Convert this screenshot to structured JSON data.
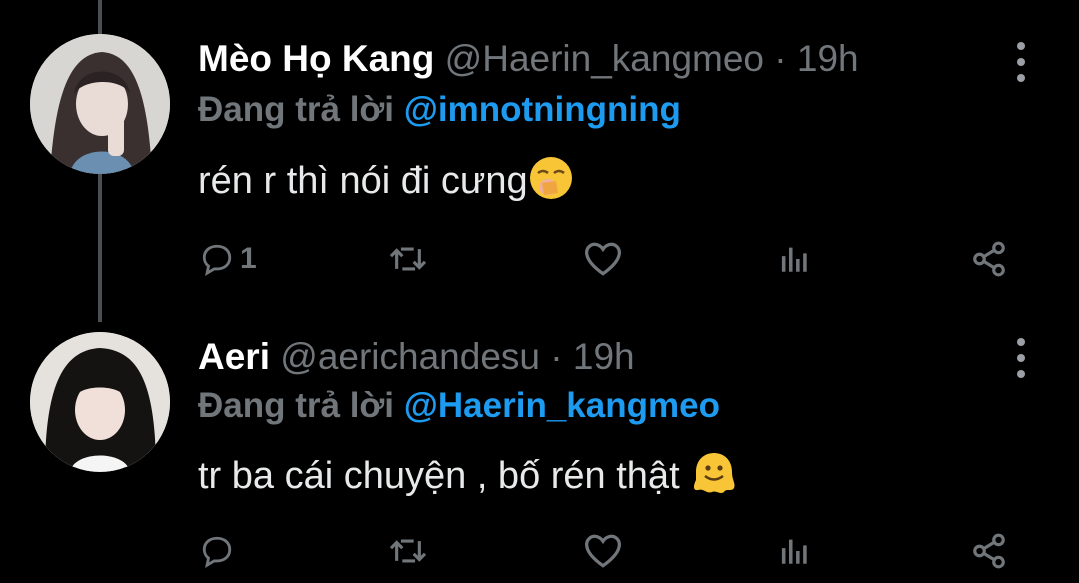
{
  "tweets": [
    {
      "name": "Mèo Họ Kang",
      "handle": "@Haerin_kangmeo",
      "separator": "·",
      "time": "19h",
      "reply_prefix": "Đang trả lời",
      "reply_to": "@imnotningning",
      "text": "rén r thì nói đi cưng",
      "emoji": "yawning-face",
      "reply_count": "1"
    },
    {
      "name": "Aeri",
      "handle": "@aerichandesu",
      "separator": "·",
      "time": "19h",
      "reply_prefix": "Đang trả lời",
      "reply_to": "@Haerin_kangmeo",
      "text": "tr ba cái chuyện , bố rén thật",
      "emoji": "melting-face",
      "reply_count": ""
    }
  ],
  "colors": {
    "background": "#000000",
    "text": "#e7e9ea",
    "muted": "#71767b",
    "mention": "#1d9bf0",
    "emoji": "#f8c536"
  }
}
